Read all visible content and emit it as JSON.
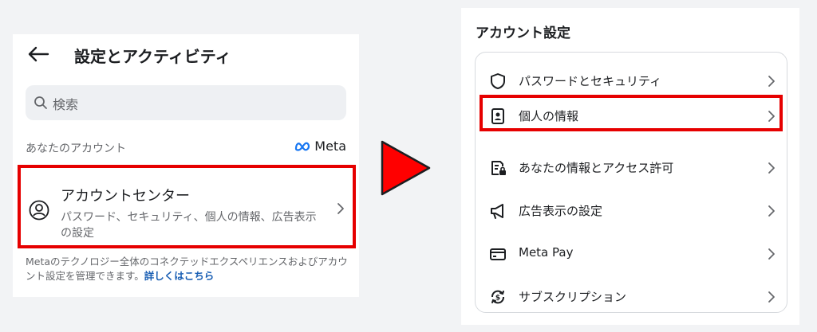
{
  "left": {
    "title": "設定とアクティビティ",
    "search_placeholder": "検索",
    "section_label": "あなたのアカウント",
    "meta_brand": "Meta",
    "account_center": {
      "title": "アカウントセンター",
      "subtitle": "パスワード、セキュリティ、個人の情報、広告表示の設定"
    },
    "footer_text": "Metaのテクノロジー全体のコネクテッドエクスペリエンスおよびアカウント設定を管理できます。",
    "footer_link": "詳しくはこちら"
  },
  "right": {
    "title": "アカウント設定",
    "items": [
      {
        "label": "パスワードとセキュリティ",
        "icon": "shield-icon"
      },
      {
        "label": "個人の情報",
        "icon": "id-card-icon"
      },
      {
        "label": "あなたの情報とアクセス許可",
        "icon": "info-lock-icon"
      },
      {
        "label": "広告表示の設定",
        "icon": "megaphone-icon"
      },
      {
        "label": "Meta Pay",
        "icon": "card-icon"
      },
      {
        "label": "サブスクリプション",
        "icon": "subscription-icon"
      }
    ]
  },
  "colors": {
    "highlight": "#e60000",
    "link": "#1a5fb4",
    "arrow": "#ff0000"
  }
}
